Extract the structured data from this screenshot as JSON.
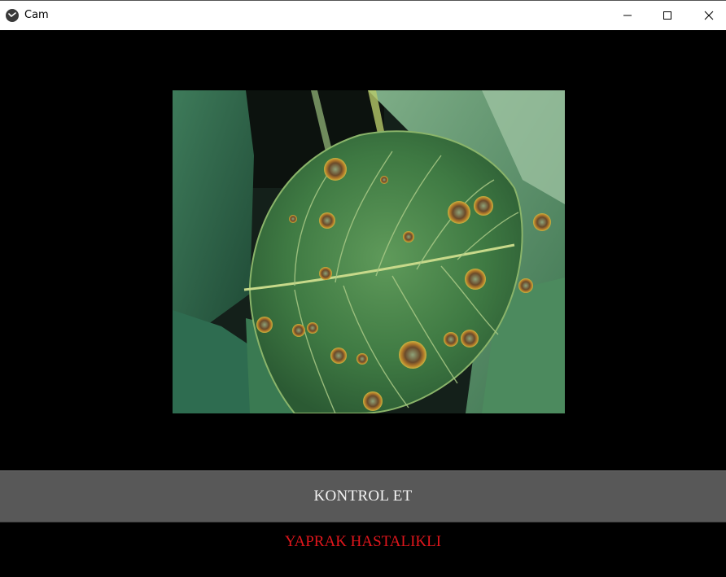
{
  "window": {
    "title": "Cam",
    "controls": {
      "minimize_icon": "minimize-icon",
      "maximize_icon": "maximize-icon",
      "close_icon": "close-icon"
    }
  },
  "camera": {
    "icon": "camera-feed-image"
  },
  "actions": {
    "check_label": "KONTROL ET"
  },
  "result": {
    "text": "YAPRAK HASTALIKLI",
    "color": "#e0161c"
  },
  "colors": {
    "background": "#000000",
    "button": "#585858",
    "button_text": "#f4f4f4"
  }
}
